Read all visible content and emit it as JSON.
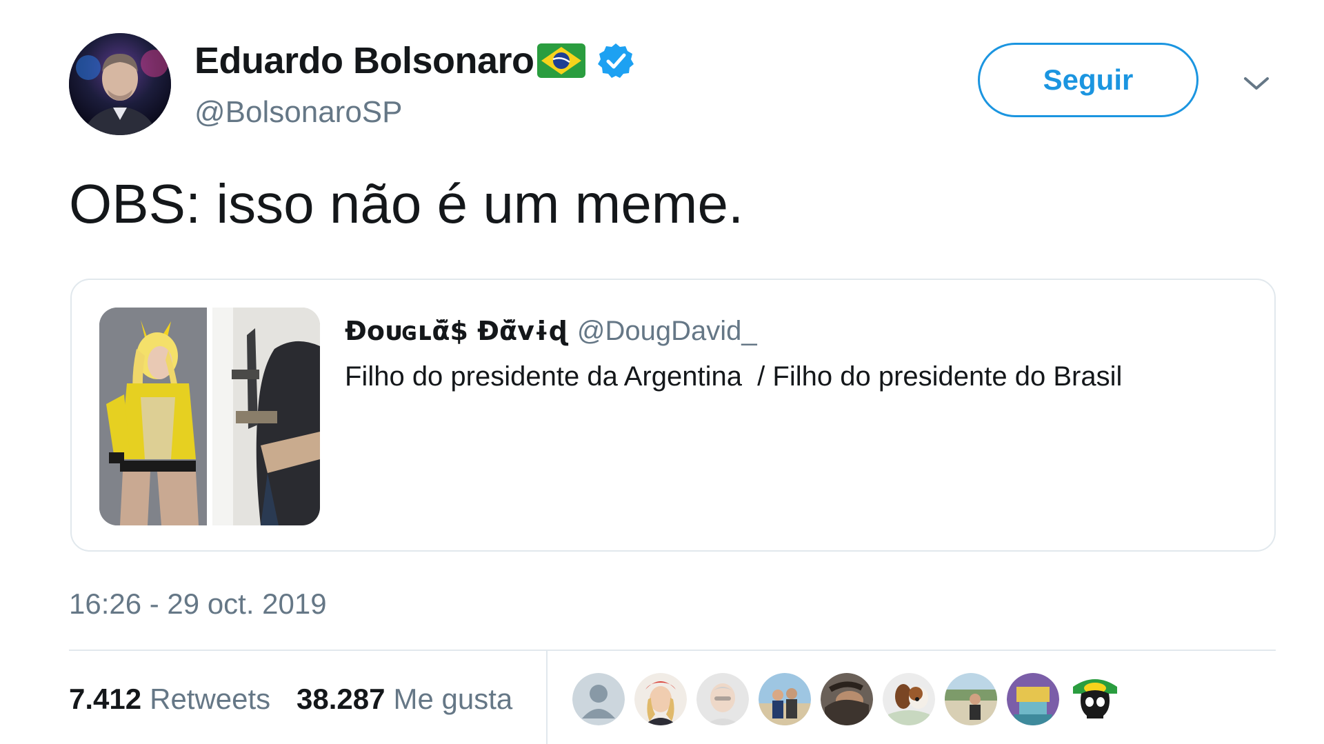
{
  "author": {
    "display_name": "Eduardo Bolsonaro",
    "flag_emoji": "brazil-flag-icon",
    "verified": true,
    "handle": "@BolsonaroSP"
  },
  "actions": {
    "follow_label": "Seguir"
  },
  "tweet": {
    "text": "OBS: isso não é um meme.",
    "timestamp": "16:26 - 29 oct. 2019"
  },
  "quoted_tweet": {
    "display_name": "Ɖoᴜɢʟᾰ̃$ Ɖᾰ̃ᴠɨɖ",
    "handle": "@DougDavid_",
    "text": "Filho do presidente da Argentina  / Filho do presidente do Brasil"
  },
  "stats": {
    "retweets_count": "7.412",
    "retweets_label": "Retweets",
    "likes_count": "38.287",
    "likes_label": "Me gusta"
  },
  "likers": [
    {
      "icon": "default-avatar-icon"
    },
    {
      "icon": "avatar"
    },
    {
      "icon": "avatar"
    },
    {
      "icon": "avatar"
    },
    {
      "icon": "avatar"
    },
    {
      "icon": "avatar"
    },
    {
      "icon": "avatar"
    },
    {
      "icon": "avatar"
    },
    {
      "icon": "avatar"
    }
  ],
  "colors": {
    "accent": "#1b95e0",
    "text_primary": "#14171a",
    "text_secondary": "#657786",
    "border": "#e1e8ed",
    "verified": "#1da1f2"
  }
}
